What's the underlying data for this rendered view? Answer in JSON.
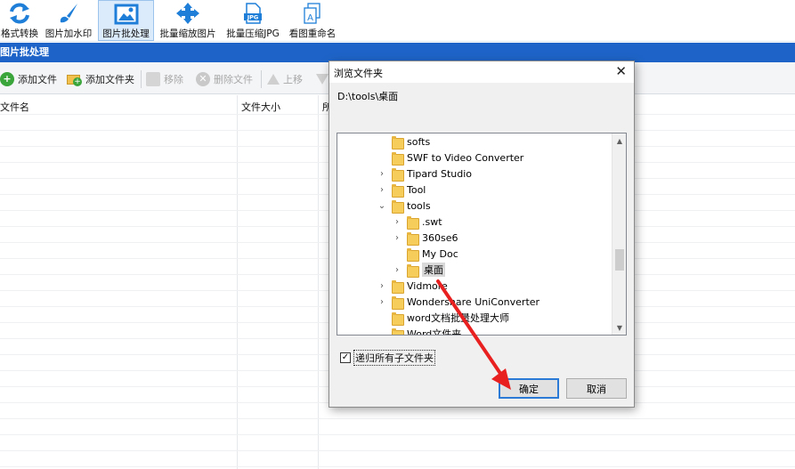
{
  "toolbar": {
    "items": [
      {
        "label": "格式转换",
        "icon": "refresh-icon"
      },
      {
        "label": "图片加水印",
        "icon": "paintbrush-icon"
      },
      {
        "label": "图片批处理",
        "icon": "image-icon",
        "active": true
      },
      {
        "label": "批量缩放图片",
        "icon": "move-arrows-icon"
      },
      {
        "label": "批量压缩JPG",
        "icon": "jpg-file-icon"
      },
      {
        "label": "看图重命名",
        "icon": "rename-icon"
      }
    ],
    "jpg_badge": "JPG",
    "rename_glyph": "A"
  },
  "title_bar": {
    "title": "图片批处理"
  },
  "sub_toolbar": {
    "add_file": "添加文件",
    "add_folder": "添加文件夹",
    "remove": "移除",
    "delete_file": "删除文件",
    "move_up": "上移"
  },
  "table": {
    "columns": [
      "文件名",
      "文件大小",
      "所"
    ]
  },
  "dialog": {
    "title": "浏览文件夹",
    "close_glyph": "✕",
    "path": "D:\\tools\\桌面",
    "tree": [
      {
        "label": "softs",
        "expander": ""
      },
      {
        "label": "SWF to Video Converter",
        "expander": ""
      },
      {
        "label": "Tipard Studio",
        "expander": "›"
      },
      {
        "label": "Tool",
        "expander": "›"
      },
      {
        "label": "tools",
        "expander": "⌄"
      },
      {
        "label": ".swt",
        "expander": "›"
      },
      {
        "label": "360se6",
        "expander": "›"
      },
      {
        "label": "My Doc",
        "expander": ""
      },
      {
        "label": "桌面",
        "expander": "›",
        "selected": true
      },
      {
        "label": "Vidmore",
        "expander": "›"
      },
      {
        "label": "Wondershare UniConverter",
        "expander": "›"
      },
      {
        "label": "word文档批量处理大师",
        "expander": ""
      },
      {
        "label": "Word文件夹",
        "expander": ""
      }
    ],
    "checkbox": {
      "label": "递归所有子文件夹",
      "checked": true,
      "mark": "✓"
    },
    "ok_label": "确定",
    "cancel_label": "取消"
  },
  "colors": {
    "title_bar": "#1e64c8",
    "annotation_arrow": "#e82020",
    "folder": "#f6cd5a"
  }
}
